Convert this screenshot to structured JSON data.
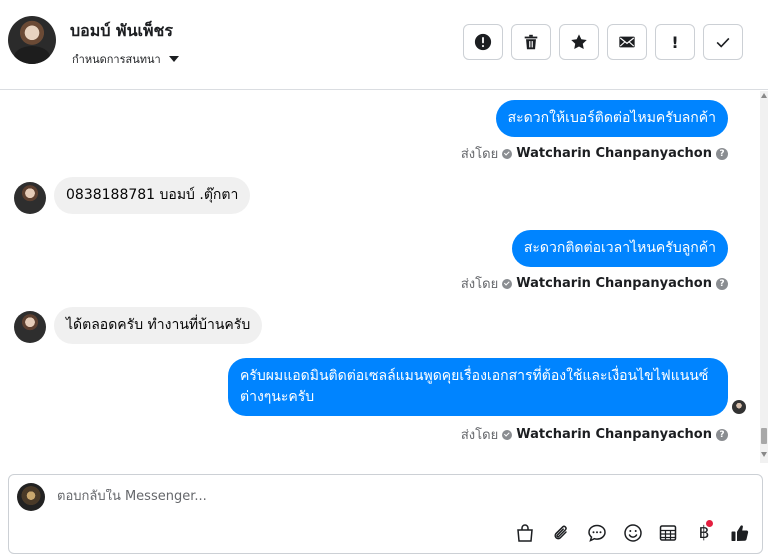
{
  "header": {
    "contact_name": "บอมบ์ พันเพ็ชร",
    "assign_label": "กำหนดการสนทนา",
    "toolbar": [
      {
        "name": "spam-button",
        "icon": "alert-circle-icon"
      },
      {
        "name": "delete-button",
        "icon": "trash-icon"
      },
      {
        "name": "star-button",
        "icon": "star-icon"
      },
      {
        "name": "mark-unread-button",
        "icon": "envelope-icon"
      },
      {
        "name": "follow-up-button",
        "icon": "exclamation-icon",
        "glyph": "!"
      },
      {
        "name": "done-button",
        "icon": "checkmark-icon"
      }
    ]
  },
  "messages": [
    {
      "direction": "out",
      "text": "สะดวกให้เบอร์ติดต่อไหมครับลกค้า"
    },
    {
      "direction": "in",
      "text": "0838188781 บอมบ์ .ตุ๊กตา"
    },
    {
      "direction": "out",
      "text": "สะดวกติดต่อเวลาไหนครับลูกค้า"
    },
    {
      "direction": "in",
      "text": "ได้ตลอดครับ ทำงานที่บ้านครับ"
    },
    {
      "direction": "out",
      "text": "ครับผมแอดมินติดต่อเซลล์แมนพูดคุยเรื่องเอกสารที่ต้องใช้และเงื่อนไขไฟแนนซ์ต่างๆนะครับ"
    }
  ],
  "sent_by": {
    "label": "ส่งโดย",
    "agent": "Watcharin Chanpanyachon",
    "help_glyph": "?"
  },
  "composer": {
    "placeholder": "ตอบกลับใน Messenger...",
    "baht_glyph": "฿",
    "tools": [
      "shopping-bag-icon",
      "paperclip-icon",
      "saved-reply-icon",
      "emoji-icon",
      "table-icon",
      "baht-icon",
      "like-icon"
    ]
  },
  "colors": {
    "outgoing_bubble": "#0084ff",
    "incoming_bubble": "#f0f0f0",
    "notification_dot": "#e41e3f"
  }
}
